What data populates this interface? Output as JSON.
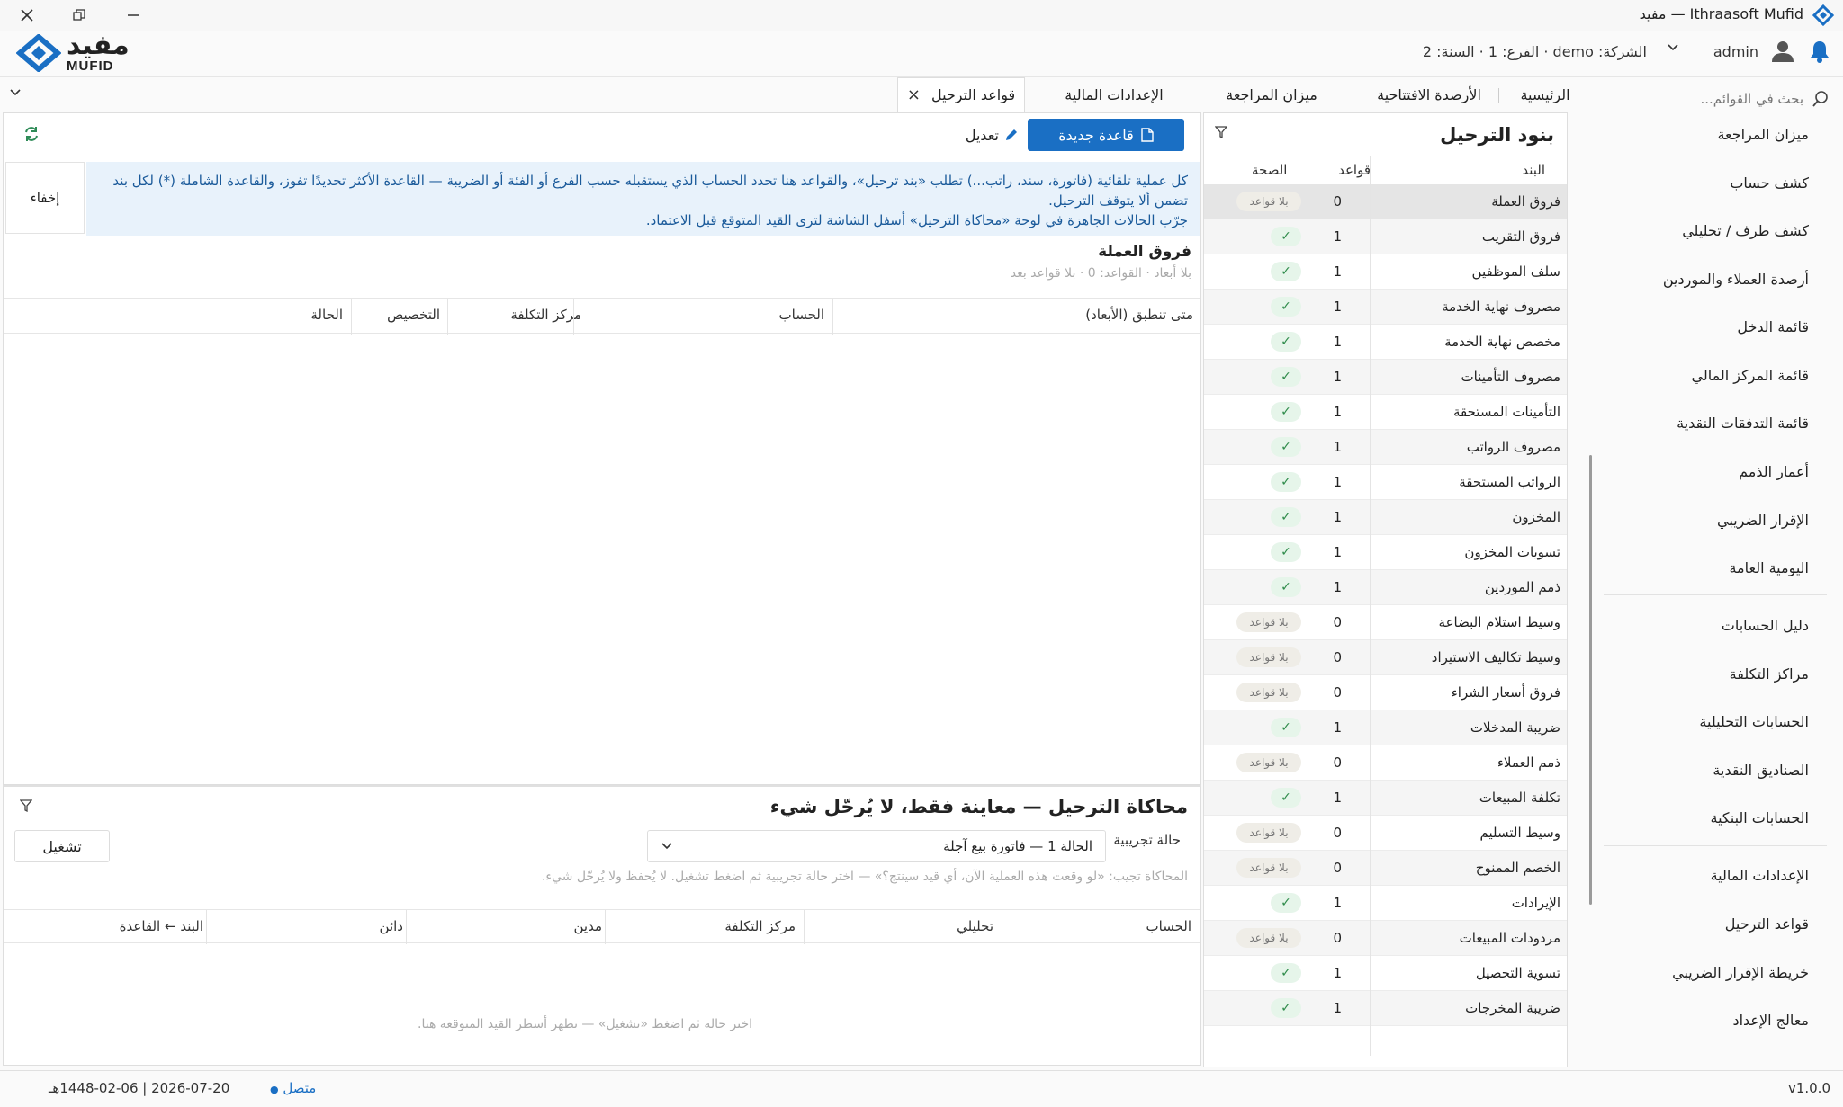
{
  "window": {
    "title": "Ithraasoft Mufid — مفيد"
  },
  "brand": {
    "name_ar": "مفيد",
    "name_en": "MUFID",
    "color": "#1a6fc4"
  },
  "header": {
    "context": "الشركة: demo · الفرع: 1 · السنة: 2",
    "user": "admin"
  },
  "sidebar": {
    "search_placeholder": "بحث في القوائم...",
    "group1": [
      "ميزان المراجعة",
      "كشف حساب",
      "كشف طرف / تحليلي",
      "أرصدة العملاء والموردين",
      "قائمة الدخل",
      "قائمة المركز المالي",
      "قائمة التدفقات النقدية",
      "أعمار الذمم",
      "الإقرار الضريبي",
      "اليومية العامة"
    ],
    "group2": [
      "دليل الحسابات",
      "مراكز التكلفة",
      "الحسابات التحليلية",
      "الصناديق النقدية",
      "الحسابات البنكية"
    ],
    "group3": [
      "الإعدادات المالية",
      "قواعد الترحيل",
      "خريطة الإقرار الضريبي",
      "معالج الإعداد"
    ]
  },
  "tabs": [
    "الرئيسية",
    "الأرصدة الافتتاحية",
    "ميزان المراجعة",
    "الإعدادات المالية",
    "قواعد الترحيل"
  ],
  "items_panel": {
    "title": "بنود الترحيل",
    "columns": {
      "item": "البند",
      "rules": "قواعد",
      "health": "الصحة"
    },
    "badge_none": "بلا قواعد",
    "badge_ok": "✓",
    "rows": [
      {
        "name": "فروق العملة",
        "count": "0",
        "ok": false
      },
      {
        "name": "فروق التقريب",
        "count": "1",
        "ok": true
      },
      {
        "name": "سلف الموظفين",
        "count": "1",
        "ok": true
      },
      {
        "name": "مصروف نهاية الخدمة",
        "count": "1",
        "ok": true
      },
      {
        "name": "مخصص نهاية الخدمة",
        "count": "1",
        "ok": true
      },
      {
        "name": "مصروف التأمينات",
        "count": "1",
        "ok": true
      },
      {
        "name": "التأمينات المستحقة",
        "count": "1",
        "ok": true
      },
      {
        "name": "مصروف الرواتب",
        "count": "1",
        "ok": true
      },
      {
        "name": "الرواتب المستحقة",
        "count": "1",
        "ok": true
      },
      {
        "name": "المخزون",
        "count": "1",
        "ok": true
      },
      {
        "name": "تسويات المخزون",
        "count": "1",
        "ok": true
      },
      {
        "name": "ذمم الموردين",
        "count": "1",
        "ok": true
      },
      {
        "name": "وسيط استلام البضاعة",
        "count": "0",
        "ok": false
      },
      {
        "name": "وسيط تكاليف الاستيراد",
        "count": "0",
        "ok": false
      },
      {
        "name": "فروق أسعار الشراء",
        "count": "0",
        "ok": false
      },
      {
        "name": "ضريبة المدخلات",
        "count": "1",
        "ok": true
      },
      {
        "name": "ذمم العملاء",
        "count": "0",
        "ok": false
      },
      {
        "name": "تكلفة المبيعات",
        "count": "1",
        "ok": true
      },
      {
        "name": "وسيط التسليم",
        "count": "0",
        "ok": false
      },
      {
        "name": "الخصم الممنوح",
        "count": "0",
        "ok": false
      },
      {
        "name": "الإيرادات",
        "count": "1",
        "ok": true
      },
      {
        "name": "مردودات المبيعات",
        "count": "0",
        "ok": false
      },
      {
        "name": "تسوية التحصيل",
        "count": "1",
        "ok": true
      },
      {
        "name": "ضريبة المخرجات",
        "count": "1",
        "ok": true
      }
    ]
  },
  "main_panel": {
    "new_rule": "قاعدة جديدة",
    "edit": "تعديل",
    "hide": "إخفاء",
    "info_line1": "كل عملية تلقائية (فاتورة، سند، راتب...) تطلب «بند ترحيل»، والقواعد هنا تحدد الحساب الذي يستقبله حسب الفرع أو الفئة أو الضريبة — القاعدة الأكثر تحديدًا تفوز، والقاعدة الشاملة (*) لكل بند",
    "info_line2": "تضمن ألا يتوقف الترحيل.",
    "info_line3": "جرّب الحالات الجاهزة في لوحة «محاكاة الترحيل» أسفل الشاشة لترى القيد المتوقع قبل الاعتماد.",
    "selected_title": "فروق العملة",
    "selected_meta": "بلا أبعاد · القواعد: 0 · بلا قواعد بعد",
    "columns": [
      "متى تنطبق (الأبعاد)",
      "الحساب",
      "مركز التكلفة",
      "التخصيص",
      "الحالة"
    ]
  },
  "simulation": {
    "title": "محاكاة الترحيل — معاينة فقط، لا يُرحّل شيء",
    "state_label": "حالة تجريبية",
    "selected_case": "الحالة 1 — فاتورة بيع آجلة",
    "run": "تشغيل",
    "hint": "المحاكاة تجيب: «لو وقعت هذه العملية الآن، أي قيد سينتج؟» — اختر حالة تجريبية ثم اضغط تشغيل. لا يُحفظ ولا يُرحّل شيء.",
    "columns": [
      "الحساب",
      "تحليلي",
      "مركز التكلفة",
      "مدين",
      "دائن",
      "البند ← القاعدة"
    ],
    "empty": "اختر حالة ثم اضغط «تشغيل» — تظهر أسطر القيد المتوقعة هنا."
  },
  "status_bar": {
    "version": "v1.0.0",
    "connection": "متصل",
    "date": "2026-07-20 | 1448-02-06هـ"
  }
}
